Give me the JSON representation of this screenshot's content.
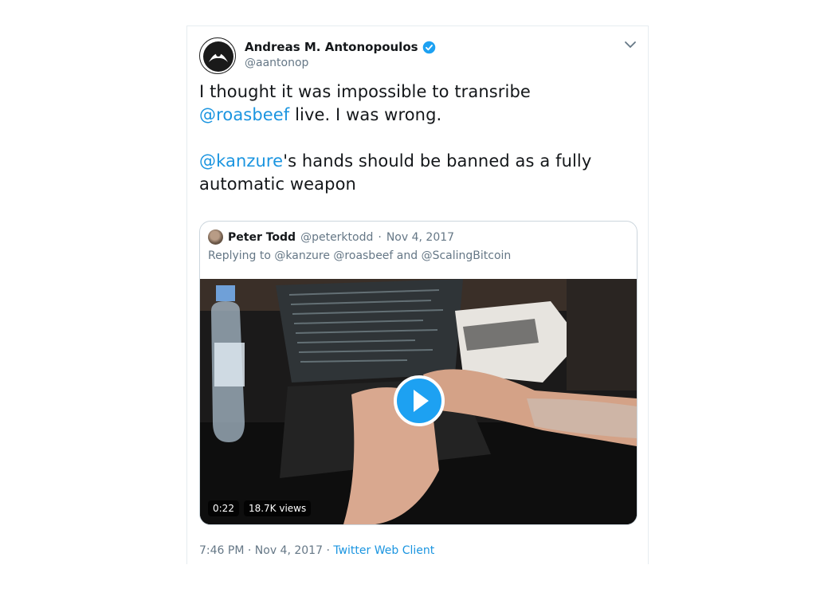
{
  "author": {
    "name": "Andreas M. Antonopoulos",
    "handle": "@aantonop",
    "verified": true,
    "avatar_icon": "black-avatar-icon"
  },
  "tweet": {
    "line1_prefix": "I thought it was impossible to transribe",
    "mention1": "@roasbeef",
    "line1_suffix": " live. I was wrong.",
    "mention2": "@kanzure",
    "line2_suffix": "'s hands should be banned as a fully automatic weapon"
  },
  "quoted": {
    "name": "Peter Todd",
    "handle": "@peterktodd",
    "separator": "·",
    "date": "Nov 4, 2017",
    "reply_line": "Replying to @kanzure @roasbeef and @ScalingBitcoin",
    "video": {
      "duration": "0:22",
      "views": "18.7K views",
      "play_icon": "play-icon"
    }
  },
  "footer": {
    "time": "7:46 PM",
    "sep1": "·",
    "date": "Nov 4, 2017",
    "sep2": "·",
    "client": "Twitter Web Client"
  },
  "colors": {
    "accent": "#1b95e0",
    "play_button": "#1da1f2",
    "text": "#14171a",
    "muted": "#657786",
    "border": "#ccd6dd"
  }
}
